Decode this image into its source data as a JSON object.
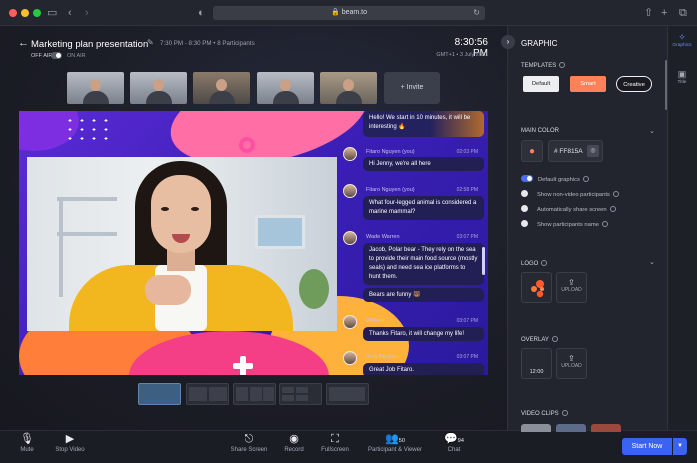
{
  "browser": {
    "url": "beam.to",
    "icons": [
      "sidebar-icon",
      "back-icon",
      "forward-icon",
      "shield-icon",
      "lock-icon",
      "reload-icon",
      "share-icon",
      "new-tab-icon",
      "tabs-icon"
    ]
  },
  "meeting": {
    "title": "Marketing plan presentation",
    "meta": "7:30 PM - 8:30 PM • 8 Participants",
    "off_air": "OFF AIR",
    "on_air": "ON AIR",
    "time": "8:30:56 PM",
    "date": "GMT+1 • 3 July 2021"
  },
  "participants": {
    "invite_label": "+ Invite"
  },
  "chat": {
    "messages": [
      {
        "name": "",
        "time": "",
        "text": "Hello! We start in 10 minutes, it will be interesting 🔥"
      },
      {
        "name": "Fitaro Nguyen (you)",
        "time": "02:03 PM",
        "text": "Hi Jenny, we're all here"
      },
      {
        "name": "Fitaro Nguyen (you)",
        "time": "02:58 PM",
        "text": "What four-legged animal is considered a marine mammal?"
      },
      {
        "name": "Wade Warren",
        "time": "03:07 PM",
        "text": "Jacob, Polar bear - They rely on the sea to provide their main food source (mostly seals) and need sea ice platforms to hunt them."
      },
      {
        "name": "",
        "time": "",
        "text": "Bears are funny 🐻"
      },
      {
        "name": "William",
        "time": "03:07 PM",
        "text": "Thanks Fitaro, it will change my life!"
      },
      {
        "name": "Jock Nguyen",
        "time": "03:07 PM",
        "text": "Great Job Fitaro."
      }
    ]
  },
  "toolbar": {
    "mute": "Mute",
    "stop_video": "Stop Video",
    "share_screen": "Share Screen",
    "record": "Record",
    "fullscreen": "Fullscreen",
    "participants": "Participant & Viewer",
    "participants_count": "50",
    "chat": "Chat",
    "chat_count": "94",
    "start_now": "Start Now"
  },
  "panel": {
    "title": "GRAPHIC",
    "templates_label": "TEMPLATES",
    "templates": [
      "Default",
      "Smart",
      "Creative"
    ],
    "main_color_label": "MAIN COLOR",
    "main_color_value": "# FF815A",
    "main_color": "#FF815A",
    "options": [
      {
        "label": "Default graphics",
        "on": true
      },
      {
        "label": "Show non-video participants",
        "on": false
      },
      {
        "label": "Automatically share screen",
        "on": false
      },
      {
        "label": "Show participants name",
        "on": false
      }
    ],
    "logo_label": "LOGO",
    "upload": "UPLOAD",
    "overlay_label": "OVERLAY",
    "overlay_time": "12:00",
    "video_clips_label": "VIDEO CLIPS"
  },
  "rail": {
    "graphics": "Graphics",
    "title": "Title"
  },
  "colors": {
    "accent": "#3B63F2",
    "smart": "#FF815A"
  }
}
